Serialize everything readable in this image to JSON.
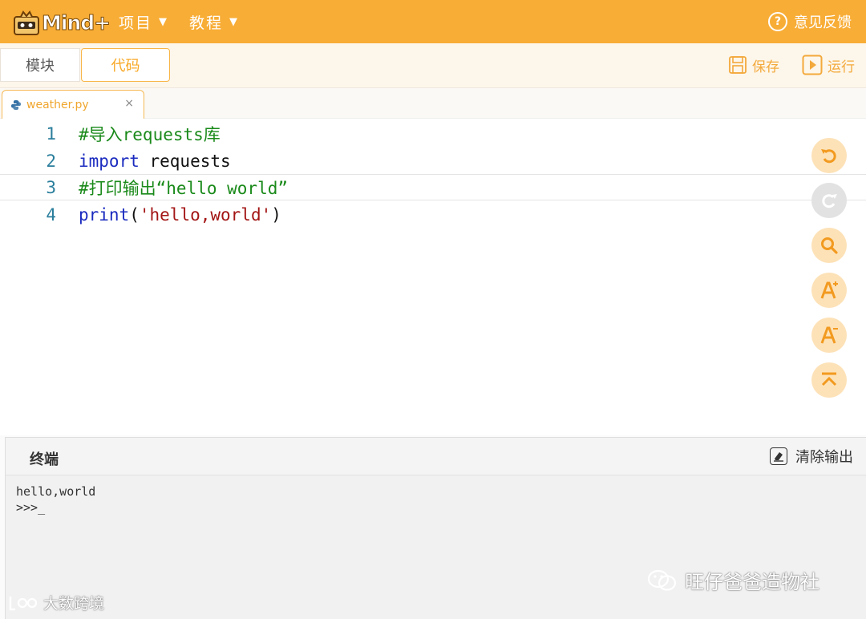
{
  "app": {
    "logo_text": "Mind+",
    "menu": [
      {
        "label": "项目"
      },
      {
        "label": "教程"
      }
    ],
    "feedback_label": "意见反馈"
  },
  "toolbar": {
    "tabs": [
      {
        "label": "模块",
        "active": false
      },
      {
        "label": "代码",
        "active": true
      }
    ],
    "save_label": "保存",
    "run_label": "运行"
  },
  "file_tab": {
    "name": "weather.py",
    "close": "×"
  },
  "editor": {
    "lines": [
      {
        "no": "1",
        "tokens": [
          {
            "t": "#导入requests库",
            "kind": "comment"
          }
        ]
      },
      {
        "no": "2",
        "tokens": [
          {
            "t": "import",
            "kind": "kw"
          },
          {
            "t": " requests",
            "kind": "plain"
          }
        ]
      },
      {
        "no": "3",
        "tokens": [
          {
            "t": "#打印输出“hello world”",
            "kind": "comment"
          }
        ]
      },
      {
        "no": "4",
        "tokens": [
          {
            "t": "print",
            "kind": "kw"
          },
          {
            "t": "(",
            "kind": "plain"
          },
          {
            "t": "'hello,world'",
            "kind": "str"
          },
          {
            "t": ")",
            "kind": "plain"
          }
        ]
      }
    ],
    "active_line": "3",
    "side_tools": [
      {
        "icon": "undo-icon",
        "enabled": true
      },
      {
        "icon": "redo-icon",
        "enabled": false
      },
      {
        "icon": "search-icon",
        "enabled": true
      },
      {
        "icon": "font-increase-icon",
        "enabled": true
      },
      {
        "icon": "font-decrease-icon",
        "enabled": true
      },
      {
        "icon": "scroll-top-icon",
        "enabled": true
      }
    ]
  },
  "terminal": {
    "title": "终端",
    "clear_label": "清除输出",
    "output": [
      "hello,world",
      ">>>_"
    ]
  },
  "watermarks": {
    "right": "旺仔爸爸造物社",
    "left": "大数跨境"
  },
  "colors": {
    "accent": "#f8ad36",
    "comment": "#1a8a1a",
    "keyword": "#1b2bbf",
    "string": "#a31515"
  }
}
